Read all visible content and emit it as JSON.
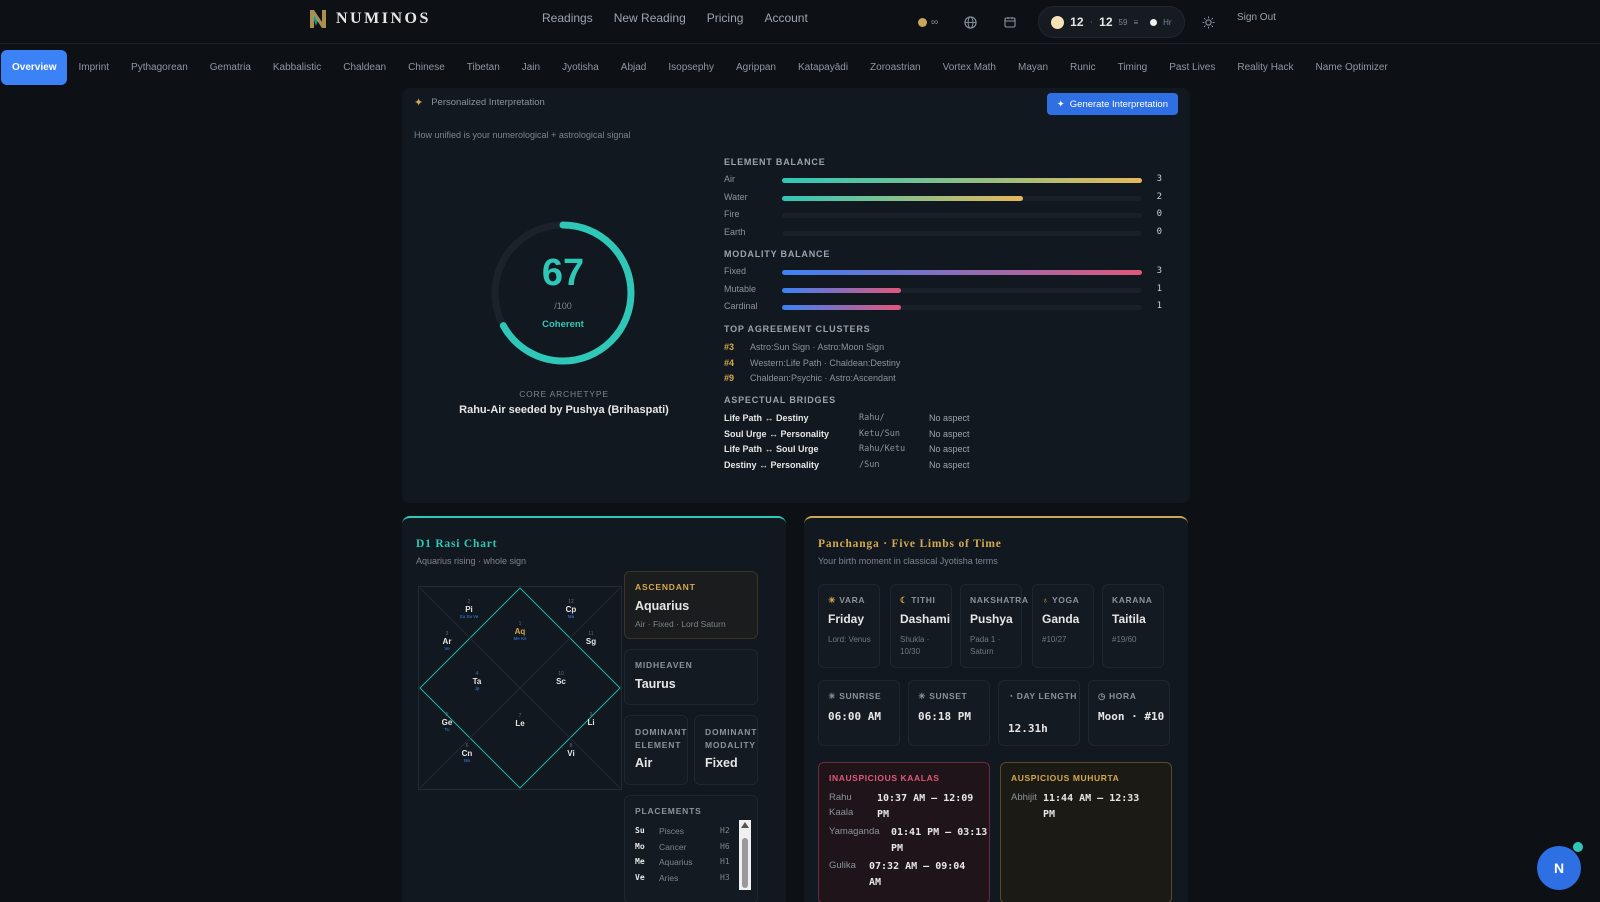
{
  "app": {
    "brand": "NUMINOS"
  },
  "nav": {
    "links": [
      "Readings",
      "New Reading",
      "Pricing",
      "Account"
    ],
    "signout": "Sign Out"
  },
  "status": {
    "credits": "∞",
    "hour": "12",
    "minute": "12",
    "seconds": "59",
    "hr_unit": "Hr"
  },
  "tabs": [
    "Overview",
    "Imprint",
    "Pythagorean",
    "Gematria",
    "Kabbalistic",
    "Chaldean",
    "Chinese",
    "Tibetan",
    "Jain",
    "Jyotisha",
    "Abjad",
    "Isopsephy",
    "Agrippan",
    "Katapayādi",
    "Zoroastrian",
    "Vortex Math",
    "Mayan",
    "Runic",
    "Timing",
    "Past Lives",
    "Reality Hack",
    "Name Optimizer"
  ],
  "active_tab": "Overview",
  "coherence": {
    "header": "Personalized Interpretation",
    "generate_label": "Generate Interpretation",
    "subtitle": "How unified is your numerological + astrological signal",
    "score": 67,
    "score_max": "/100",
    "score_label": "Coherent",
    "archetype_caption": "CORE ARCHETYPE",
    "archetype": "Rahu-Air seeded by Pushya (Brihaspati)",
    "element_title": "ELEMENT BALANCE",
    "elements": [
      {
        "name": "Air",
        "count": "3",
        "fraction": 1.0
      },
      {
        "name": "Water",
        "count": "2",
        "fraction": 0.67
      },
      {
        "name": "Fire",
        "count": "0",
        "fraction": 0
      },
      {
        "name": "Earth",
        "count": "0",
        "fraction": 0
      }
    ],
    "modality_title": "MODALITY BALANCE",
    "modalities": [
      {
        "name": "Fixed",
        "count": "3",
        "fraction": 1.0
      },
      {
        "name": "Mutable",
        "count": "1",
        "fraction": 0.33
      },
      {
        "name": "Cardinal",
        "count": "1",
        "fraction": 0.33
      }
    ],
    "clusters_title": "TOP AGREEMENT CLUSTERS",
    "clusters": [
      {
        "num": "#3",
        "text": "Astro:Sun Sign · Astro:Moon Sign"
      },
      {
        "num": "#4",
        "text": "Western:Life Path · Chaldean:Destiny"
      },
      {
        "num": "#9",
        "text": "Chaldean:Psychic · Astro:Ascendant"
      }
    ],
    "bridges_title": "ASPECTUAL BRIDGES",
    "bridges": [
      {
        "pair": "Life Path ↔ Destiny",
        "planets": "Rahu/",
        "aspect": "No aspect"
      },
      {
        "pair": "Soul Urge ↔ Personality",
        "planets": "Ketu/Sun",
        "aspect": "No aspect"
      },
      {
        "pair": "Life Path ↔ Soul Urge",
        "planets": "Rahu/Ketu",
        "aspect": "No aspect"
      },
      {
        "pair": "Destiny ↔ Personality",
        "planets": "/Sun",
        "aspect": "No aspect"
      }
    ]
  },
  "rasi": {
    "title": "D1 Rasi Chart",
    "subtitle": "Aquarius rising · whole sign",
    "houses": [
      {
        "n": "1",
        "sign": "Aq",
        "planets": "Me Ke",
        "asc": true
      },
      {
        "n": "2",
        "sign": "Pi",
        "planets": "Su Sa Ve",
        "asc": false
      },
      {
        "n": "3",
        "sign": "Ar",
        "planets": "Ve",
        "asc": false
      },
      {
        "n": "4",
        "sign": "Ta",
        "planets": "Jp",
        "asc": false
      },
      {
        "n": "5",
        "sign": "Ge",
        "planets": "Tu",
        "asc": false
      },
      {
        "n": "6",
        "sign": "Cn",
        "planets": "Mo",
        "asc": false
      },
      {
        "n": "7",
        "sign": "Le",
        "planets": "",
        "asc": false
      },
      {
        "n": "8",
        "sign": "Vi",
        "planets": "",
        "asc": false
      },
      {
        "n": "9",
        "sign": "Li",
        "planets": "",
        "asc": false
      },
      {
        "n": "10",
        "sign": "Sc",
        "planets": "",
        "asc": false
      },
      {
        "n": "11",
        "sign": "Sg",
        "planets": "",
        "asc": false
      },
      {
        "n": "12",
        "sign": "Cp",
        "planets": "Ma",
        "asc": false
      }
    ],
    "ascendant_caption": "ASCENDANT",
    "ascendant": "Aquarius",
    "ascendant_meta": "Air · Fixed · Lord Saturn",
    "midheaven_caption": "MIDHEAVEN",
    "midheaven": "Taurus",
    "dom_element_caption": "DOMINANT ELEMENT",
    "dom_element": "Air",
    "dom_modality_caption": "DOMINANT MODALITY",
    "dom_modality": "Fixed",
    "placements_caption": "PLACEMENTS",
    "placements": [
      {
        "p": "Su",
        "s": "Pisces",
        "h": "H2"
      },
      {
        "p": "Mo",
        "s": "Cancer",
        "h": "H6"
      },
      {
        "p": "Me",
        "s": "Aquarius",
        "h": "H1"
      },
      {
        "p": "Ve",
        "s": "Aries",
        "h": "H3"
      }
    ]
  },
  "panchanga": {
    "title": "Panchanga · Five Limbs of Time",
    "subtitle": "Your birth moment in classical Jyotisha terms",
    "limbs": [
      {
        "cap": "VARA",
        "val": "Friday",
        "meta": "Lord: Venus"
      },
      {
        "cap": "TITHI",
        "val": "Dashami",
        "meta": "Shukla · 10/30"
      },
      {
        "cap": "NAKSHATRA",
        "val": "Pushya",
        "meta": "Pada 1 · Saturn"
      },
      {
        "cap": "YOGA",
        "val": "Ganda",
        "meta": "#10/27"
      },
      {
        "cap": "KARANA",
        "val": "Taitila",
        "meta": "#19/60"
      }
    ],
    "sun": [
      {
        "cap": "SUNRISE",
        "val": "06:00 AM"
      },
      {
        "cap": "SUNSET",
        "val": "06:18 PM"
      },
      {
        "cap": "DAY LENGTH",
        "val": "12.31h"
      },
      {
        "cap": "HORA",
        "val": "Moon · #10"
      }
    ],
    "inauspicious_caption": "INAUSPICIOUS KAALAS",
    "inauspicious": [
      {
        "k": "Rahu Kaala",
        "t": "10:37 AM – 12:09 PM"
      },
      {
        "k": "Yamaganda",
        "t": "01:41 PM – 03:13 PM"
      },
      {
        "k": "Gulika",
        "t": "07:32 AM – 09:04 AM"
      }
    ],
    "auspicious_caption": "AUSPICIOUS MUHURTA",
    "auspicious": [
      {
        "k": "Abhijit",
        "t": "11:44 AM – 12:33 PM"
      }
    ]
  },
  "colors": {
    "teal": "#2ec7b8",
    "gold": "#d4a94d",
    "blue": "#3b82f6",
    "pink": "#e0587a"
  }
}
